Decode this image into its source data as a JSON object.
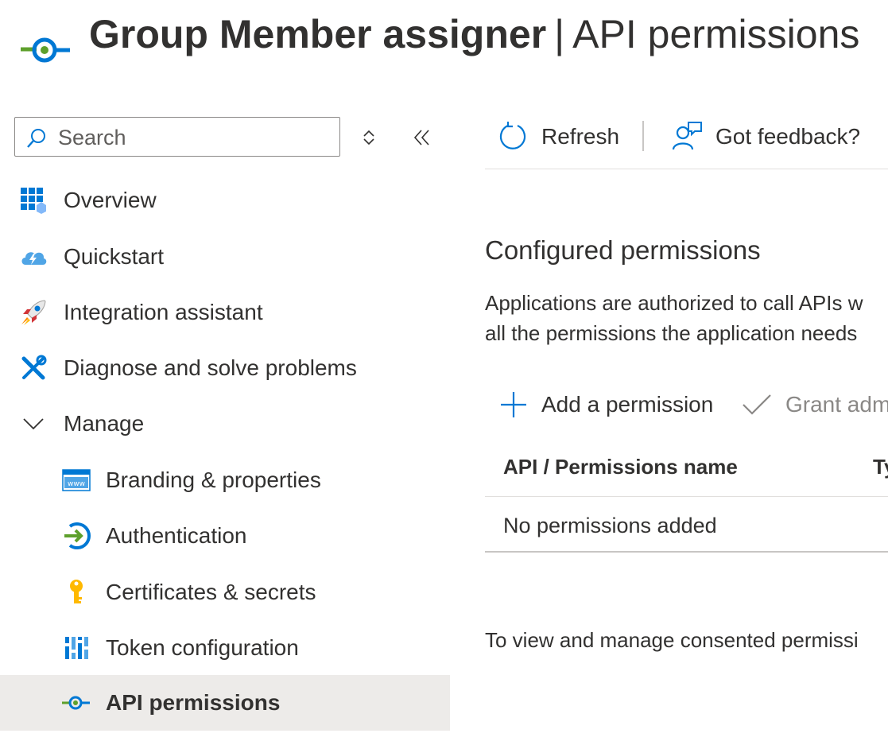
{
  "header": {
    "app_name": "Group Member assigner",
    "separator": "|",
    "section": "API permissions",
    "icon": "api-permissions-icon"
  },
  "sidebar": {
    "search_placeholder": "Search",
    "items": [
      {
        "label": "Overview",
        "icon": "overview-icon"
      },
      {
        "label": "Quickstart",
        "icon": "quickstart-cloud-icon"
      },
      {
        "label": "Integration assistant",
        "icon": "rocket-icon"
      },
      {
        "label": "Diagnose and solve problems",
        "icon": "tools-icon"
      },
      {
        "label": "Manage",
        "icon": "chevron-down-icon",
        "expanded": true
      },
      {
        "label": "Branding & properties",
        "icon": "branding-www-icon"
      },
      {
        "label": "Authentication",
        "icon": "authentication-icon"
      },
      {
        "label": "Certificates & secrets",
        "icon": "key-icon"
      },
      {
        "label": "Token configuration",
        "icon": "token-bars-icon"
      },
      {
        "label": "API permissions",
        "icon": "api-permissions-icon",
        "selected": true
      }
    ]
  },
  "toolbar": {
    "refresh_label": "Refresh",
    "feedback_label": "Got feedback?"
  },
  "main": {
    "heading": "Configured permissions",
    "description_line1": "Applications are authorized to call APIs w",
    "description_line2": "all the permissions the application needs",
    "add_permission_label": "Add a permission",
    "grant_label": "Grant adm",
    "table": {
      "col_name": "API / Permissions name",
      "col_type": "Ty",
      "empty_text": "No permissions added"
    },
    "footer_note": "To view and manage consented permissi"
  },
  "colors": {
    "accent": "#0078d4",
    "selected_bg": "#edebe9",
    "text": "#323130",
    "disabled_text": "#8a8886",
    "green": "#5ea02c"
  }
}
